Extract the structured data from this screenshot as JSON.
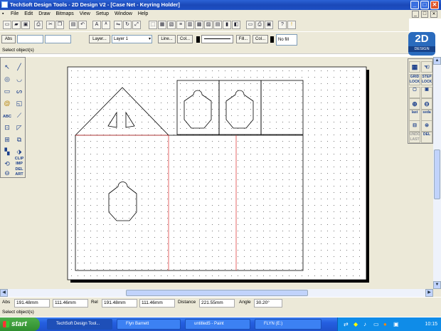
{
  "window": {
    "title": "TechSoft Design Tools - 2D Design V2 - [Case Net - Keyring Holder]",
    "min": "_",
    "max": "□",
    "close": "✕",
    "mdi_min": "_",
    "mdi_max": "□",
    "mdi_close": "✕"
  },
  "menu": [
    "File",
    "Edit",
    "Draw",
    "Bitmaps",
    "View",
    "Setup",
    "Window",
    "Help"
  ],
  "props": {
    "abs_label": "Abs",
    "layer_button": "Layer...",
    "layer_value": "Layer 1",
    "line_button": "Line...",
    "col1_button": "Col...",
    "fill_button": "Fill...",
    "col2_button": "Col...",
    "fill_value": "No fill"
  },
  "status_top": "Select object(s)",
  "logo": {
    "big": "2D",
    "small": "DESIGN"
  },
  "left_tools": {
    "clip": "CLIP\nIMP",
    "del": "DEL\nART",
    "abc": "ABC"
  },
  "right_tools": {
    "grid": "GRID\nLOCK",
    "step": "STEP\nLOCK",
    "last": "last",
    "seda": "seda",
    "undo": "UNDO\nLAST",
    "del": "DEL"
  },
  "coords": {
    "abs_label": "Abs",
    "abs_x": "191.48mm",
    "abs_y": "111.46mm",
    "rel_label": "Rel",
    "rel_x": "191.48mm",
    "rel_y": "111.46mm",
    "distance_label": "Distance",
    "distance": "221.55mm",
    "angle_label": "Angle",
    "angle": "30.20°"
  },
  "status_bottom": "Select object(s)",
  "taskbar": {
    "start": "start",
    "tasks": [
      "TechSoft Design Tool...",
      "Flyn Barnett",
      "untitled5 - Paint",
      "FLYN (E:)"
    ],
    "time": "10:15"
  },
  "colors": {
    "titlebar": "#1d4fc4",
    "red_folds": "#e04040",
    "taskbar": "#245ee0",
    "start": "#3c9a3c"
  }
}
